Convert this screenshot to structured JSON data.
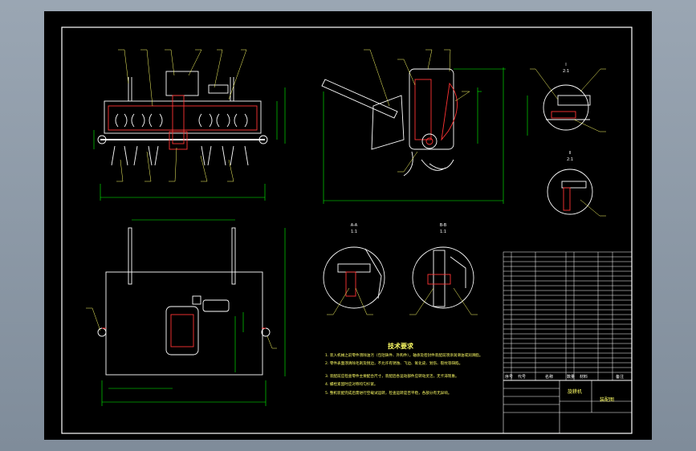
{
  "technical_requirements": {
    "title": "技术要求",
    "items": [
      "1. 装入机械之前零件须除油污（包括铸件、外购件），轴承及密封件装配前须涂润滑油或润滑脂。",
      "2. 零件表面须清除毛刺及锐边，不允许有锈蚀、飞边、氧化皮、划伤、裂纹等缺陷。",
      "3. 装配前应检查零件主要配合尺寸，装配后各运动部件应转动灵活，无卡滞现象。",
      "4. 螺栓紧固时应对称均匀拧紧。",
      "5. 整机装配完成后需进行空载试运转，检查运转是否平稳，各部分有无异响。"
    ]
  },
  "title_block": {
    "drawing_name": "旋耕机",
    "drawing_number": "装配图",
    "header_labels": [
      "序号",
      "代号",
      "名称",
      "数量",
      "材料",
      "备注"
    ]
  },
  "section_labels": {
    "detail_1": [
      "I",
      "2:1"
    ],
    "detail_2": [
      "II",
      "2:1"
    ],
    "detail_3": [
      "A-A",
      "1:1"
    ],
    "detail_4": [
      "B-B",
      "1:1"
    ]
  },
  "colors": {
    "outline": "#ffffff",
    "part": "#ffffff",
    "section_hatch": "#ff3333",
    "dimension": "#00ff00",
    "leader": "#ffff66",
    "text": "#ffff66",
    "frame_bg": "#000000"
  }
}
